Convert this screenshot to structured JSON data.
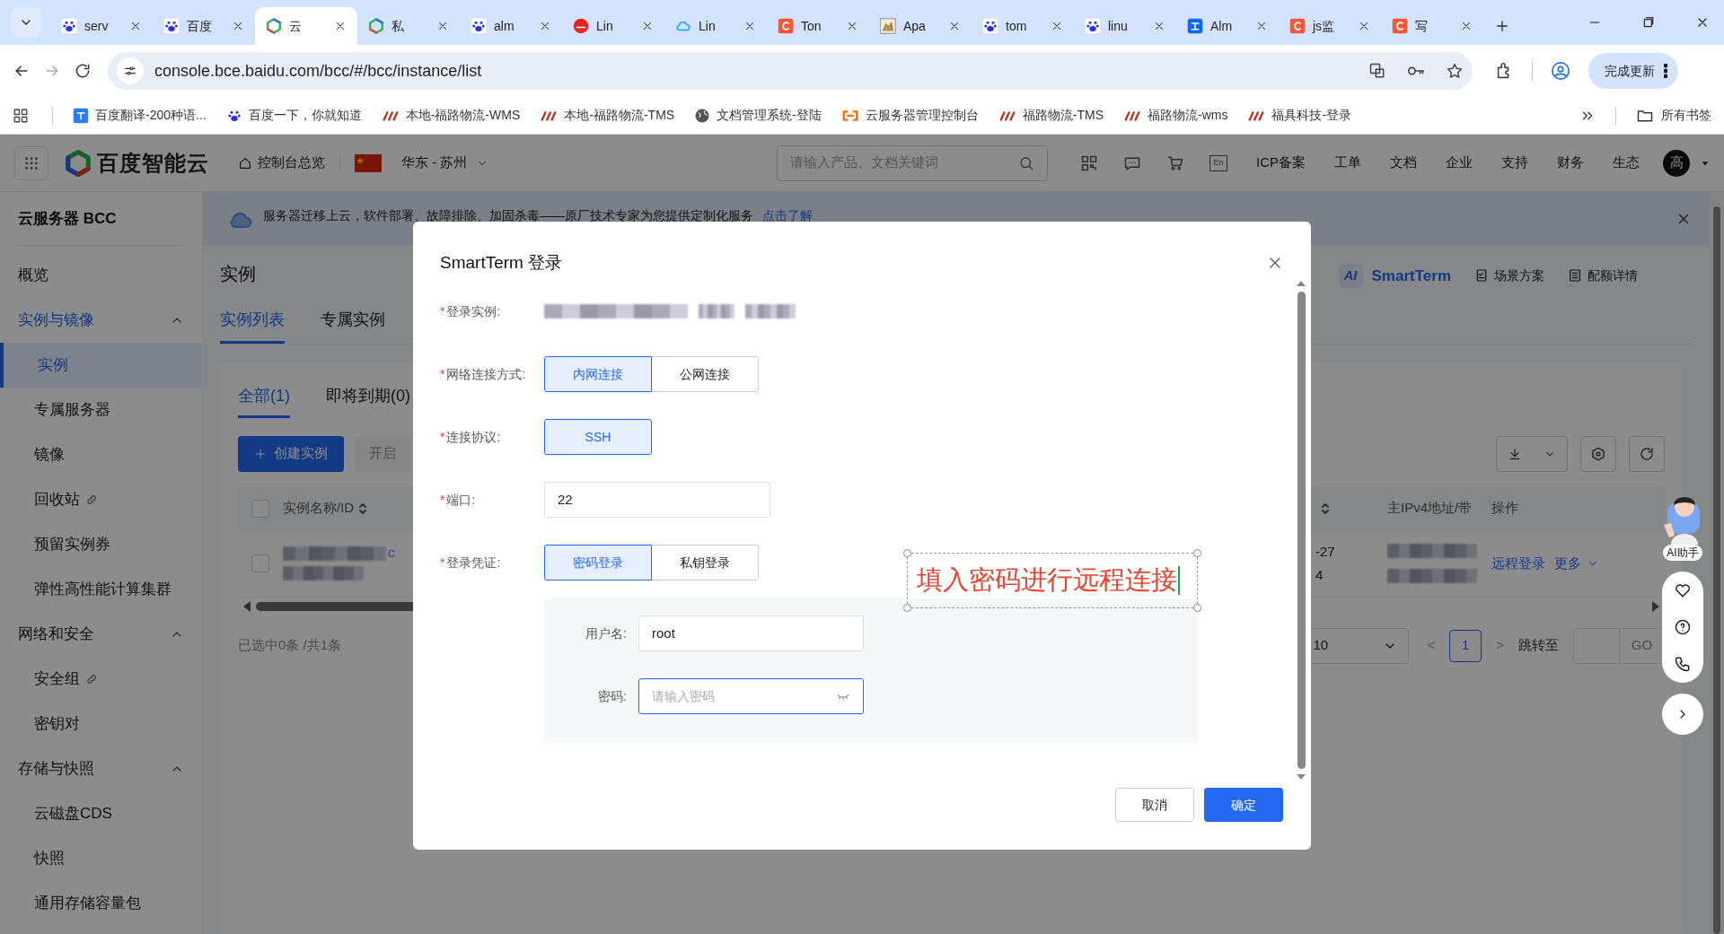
{
  "browser": {
    "tabs": [
      {
        "title": "serv",
        "kind": "paw",
        "selected": false
      },
      {
        "title": "百度",
        "kind": "paw",
        "selected": false
      },
      {
        "title": "云",
        "kind": "cube",
        "selected": true
      },
      {
        "title": "私",
        "kind": "cube",
        "selected": false
      },
      {
        "title": "alm",
        "kind": "paw",
        "selected": false
      },
      {
        "title": "Lin",
        "kind": "php",
        "selected": false
      },
      {
        "title": "Lin",
        "kind": "cloud",
        "selected": false
      },
      {
        "title": "Ton",
        "kind": "c",
        "selected": false
      },
      {
        "title": "Apa",
        "kind": "cat",
        "selected": false
      },
      {
        "title": "tom",
        "kind": "paw",
        "selected": false
      },
      {
        "title": "linu",
        "kind": "paw",
        "selected": false
      },
      {
        "title": "Alm",
        "kind": "zhi",
        "selected": false
      },
      {
        "title": "js监",
        "kind": "c",
        "selected": false
      },
      {
        "title": "写",
        "kind": "c",
        "selected": false
      }
    ],
    "url": "console.bce.baidu.com/bcc/#/bcc/instance/list",
    "update_button": "完成更新",
    "bookmarks": [
      {
        "label": "百度翻译-200种语...",
        "kind": "translate"
      },
      {
        "label": "百度一下，你就知道",
        "kind": "paw"
      },
      {
        "label": "本地-福路物流-WMS",
        "kind": "jfl"
      },
      {
        "label": "本地-福路物流-TMS",
        "kind": "jfl"
      },
      {
        "label": "文档管理系统-登陆",
        "kind": "globe"
      },
      {
        "label": "云服务器管理控制台",
        "kind": "bracket"
      },
      {
        "label": "福路物流-TMS",
        "kind": "jfl"
      },
      {
        "label": "福路物流-wms",
        "kind": "jfl"
      },
      {
        "label": "福具科技-登录",
        "kind": "jfl"
      }
    ],
    "all_bookmarks": "所有书签"
  },
  "header": {
    "logo": "百度智能云",
    "overview": "控制台总览",
    "region": "华东 - 苏州",
    "search_placeholder": "请输入产品、文档关键词",
    "language": "En",
    "nav": [
      "ICP备案",
      "工单",
      "文档",
      "企业",
      "支持",
      "财务",
      "生态"
    ],
    "avatar": "高"
  },
  "sidebar": {
    "title": "云服务器 BCC",
    "items": [
      {
        "label": "概览",
        "selected": false
      },
      {
        "label": "实例与镜像",
        "expanded": true,
        "children": [
          {
            "label": "实例",
            "selected": true,
            "external": false
          },
          {
            "label": "专属服务器",
            "selected": false,
            "external": false
          },
          {
            "label": "镜像",
            "selected": false,
            "external": false
          },
          {
            "label": "回收站",
            "selected": false,
            "external": true
          },
          {
            "label": "预留实例券",
            "selected": false,
            "external": false
          },
          {
            "label": "弹性高性能计算集群",
            "selected": false,
            "external": false
          }
        ]
      },
      {
        "label": "网络和安全",
        "expanded": true,
        "children": [
          {
            "label": "安全组",
            "selected": false,
            "external": true
          },
          {
            "label": "密钥对",
            "selected": false,
            "external": false
          }
        ]
      },
      {
        "label": "存储与快照",
        "expanded": true,
        "children": [
          {
            "label": "云磁盘CDS",
            "selected": false,
            "external": false
          },
          {
            "label": "快照",
            "selected": false,
            "external": false
          },
          {
            "label": "通用存储容量包",
            "selected": false,
            "external": false
          }
        ]
      }
    ]
  },
  "main": {
    "banner": {
      "text": "服务器迁移上云，软件部署、故障排除、加固杀毒——原厂技术专家为您提供定制化服务",
      "link": "点击了解"
    },
    "title": "实例",
    "tabs": [
      {
        "label": "实例列表",
        "selected": true
      },
      {
        "label": "专属实例",
        "selected": false
      }
    ],
    "ai_badge": "AI",
    "smartterm": "SmartTerm",
    "links": [
      "场景方案",
      "配额详情"
    ],
    "filter_tabs": [
      {
        "label": "全部(1)",
        "selected": true
      },
      {
        "label": "即将到期(0)",
        "selected": false
      }
    ],
    "create_button": "创建实例",
    "start_button": "开启",
    "table": {
      "header_checked": false,
      "columns": [
        "实例名称/ID",
        "主IPv4地址/带",
        "操作"
      ],
      "row": {
        "checked": false,
        "name_suffix": "C",
        "cells": [
          "-27",
          "4"
        ],
        "actions": [
          "远程登录",
          "更多"
        ]
      }
    },
    "selection": "已选中0条 /共1条",
    "pagination": {
      "page_size": "10",
      "prev": "<",
      "page": "1",
      "next": ">",
      "jump": "跳转至",
      "go": "GO"
    }
  },
  "assistant": {
    "label": "AI助手"
  },
  "dialog": {
    "title": "SmartTerm 登录",
    "fields": [
      {
        "kind": "redacted",
        "mark": "*",
        "label": "登录实例:"
      },
      {
        "kind": "segmented",
        "mark": "*",
        "label": "网络连接方式:",
        "options": [
          {
            "label": "内网连接",
            "selected": true
          },
          {
            "label": "公网连接",
            "selected": false
          }
        ]
      },
      {
        "kind": "segmented",
        "mark": "*",
        "label": "连接协议:",
        "options": [
          {
            "label": "SSH",
            "selected": true
          }
        ]
      },
      {
        "kind": "input",
        "mark": "*",
        "label": "端口:",
        "value": "22"
      },
      {
        "kind": "segmented",
        "mark": "*",
        "label": "登录凭证:",
        "options": [
          {
            "label": "密码登录",
            "selected": true
          },
          {
            "label": "私钥登录",
            "selected": false
          }
        ]
      }
    ],
    "username": {
      "label": "用户名:",
      "value": "root"
    },
    "password": {
      "label": "密码:",
      "placeholder": "请输入密码"
    },
    "annotation": "填入密码进行远程连接",
    "cancel": "取消",
    "ok": "确定"
  }
}
